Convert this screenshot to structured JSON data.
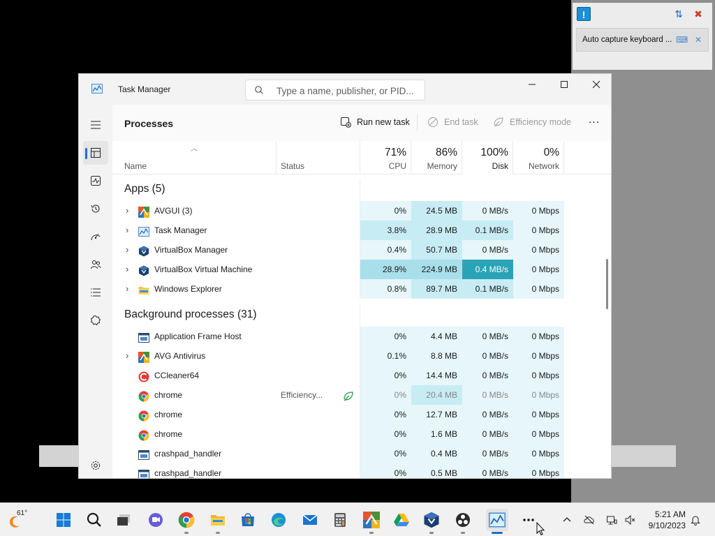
{
  "window": {
    "title": "Task Manager",
    "search_placeholder": "Type a name, publisher, or PID..."
  },
  "nav": {
    "items": [
      "menu-icon",
      "processes-icon",
      "performance-icon",
      "app-history-icon",
      "startup-apps-icon",
      "users-icon",
      "details-icon",
      "services-icon",
      "settings-icon"
    ],
    "active": "processes"
  },
  "toolbar": {
    "page_title": "Processes",
    "run_new_task": "Run new task",
    "end_task": "End task",
    "efficiency_mode": "Efficiency mode",
    "more": "..."
  },
  "columns": {
    "name": "Name",
    "status": "Status",
    "cpu": {
      "pct": "71%",
      "label": "CPU"
    },
    "memory": {
      "pct": "86%",
      "label": "Memory"
    },
    "disk": {
      "pct": "100%",
      "label": "Disk"
    },
    "network": {
      "pct": "0%",
      "label": "Network"
    }
  },
  "groups": {
    "apps": "Apps (5)",
    "background": "Background processes (31)"
  },
  "apps": [
    {
      "name": "AVGUI (3)",
      "status": "",
      "cpu": "0%",
      "memory": "24.5 MB",
      "disk": "0 MB/s",
      "network": "0 Mbps",
      "icon": "avg-icon",
      "expandable": true
    },
    {
      "name": "Task Manager",
      "status": "",
      "cpu": "3.8%",
      "memory": "28.9 MB",
      "disk": "0.1 MB/s",
      "network": "0 Mbps",
      "icon": "task-manager-icon",
      "expandable": true
    },
    {
      "name": "VirtualBox Manager",
      "status": "",
      "cpu": "0.4%",
      "memory": "50.7 MB",
      "disk": "0 MB/s",
      "network": "0 Mbps",
      "icon": "virtualbox-icon",
      "expandable": true
    },
    {
      "name": "VirtualBox Virtual Machine",
      "status": "",
      "cpu": "28.9%",
      "memory": "224.9 MB",
      "disk": "0.4 MB/s",
      "network": "0 Mbps",
      "icon": "virtualbox-icon",
      "expandable": true
    },
    {
      "name": "Windows Explorer",
      "status": "",
      "cpu": "0.8%",
      "memory": "89.7 MB",
      "disk": "0.1 MB/s",
      "network": "0 Mbps",
      "icon": "folder-icon",
      "expandable": true
    }
  ],
  "background": [
    {
      "name": "Application Frame Host",
      "status": "",
      "cpu": "0%",
      "memory": "4.4 MB",
      "disk": "0 MB/s",
      "network": "0 Mbps",
      "icon": "app-frame-icon",
      "expandable": false
    },
    {
      "name": "AVG Antivirus",
      "status": "",
      "cpu": "0.1%",
      "memory": "8.8 MB",
      "disk": "0 MB/s",
      "network": "0 Mbps",
      "icon": "avg-icon",
      "expandable": true
    },
    {
      "name": "CCleaner64",
      "status": "",
      "cpu": "0%",
      "memory": "14.4 MB",
      "disk": "0 MB/s",
      "network": "0 Mbps",
      "icon": "ccleaner-icon",
      "expandable": false
    },
    {
      "name": "chrome",
      "status": "Efficiency...",
      "cpu": "0%",
      "memory": "20.4 MB",
      "disk": "0 MB/s",
      "network": "0 Mbps",
      "icon": "chrome-icon",
      "expandable": false,
      "efficiency": true
    },
    {
      "name": "chrome",
      "status": "",
      "cpu": "0%",
      "memory": "12.7 MB",
      "disk": "0 MB/s",
      "network": "0 Mbps",
      "icon": "chrome-icon",
      "expandable": false
    },
    {
      "name": "chrome",
      "status": "",
      "cpu": "0%",
      "memory": "1.6 MB",
      "disk": "0 MB/s",
      "network": "0 Mbps",
      "icon": "chrome-icon",
      "expandable": false
    },
    {
      "name": "crashpad_handler",
      "status": "",
      "cpu": "0%",
      "memory": "0.4 MB",
      "disk": "0 MB/s",
      "network": "0 Mbps",
      "icon": "app-frame-icon",
      "expandable": false
    },
    {
      "name": "crashpad_handler",
      "status": "",
      "cpu": "0%",
      "memory": "0.5 MB",
      "disk": "0 MB/s",
      "network": "0 Mbps",
      "icon": "app-frame-icon",
      "expandable": false
    }
  ],
  "heat_colors": {
    "light": "#e6f6fa",
    "mid": "#c8ecf3",
    "strong": "#a8dfeb",
    "hot": "#2ba3b7"
  },
  "vbox_panel": {
    "toast_text": "Auto capture keyboard ..."
  },
  "taskbar": {
    "weather_temp": "61°",
    "apps": [
      "start-icon",
      "search-icon",
      "task-view-icon",
      "teams-chat-icon",
      "chrome-icon",
      "file-explorer-icon",
      "microsoft-store-icon",
      "edge-icon",
      "mail-icon",
      "calculator-icon",
      "avg-icon",
      "google-drive-icon",
      "virtualbox-icon",
      "obs-icon",
      "task-manager-icon",
      "more-apps-icon"
    ],
    "time": "5:21 AM",
    "date": "9/10/2023"
  }
}
